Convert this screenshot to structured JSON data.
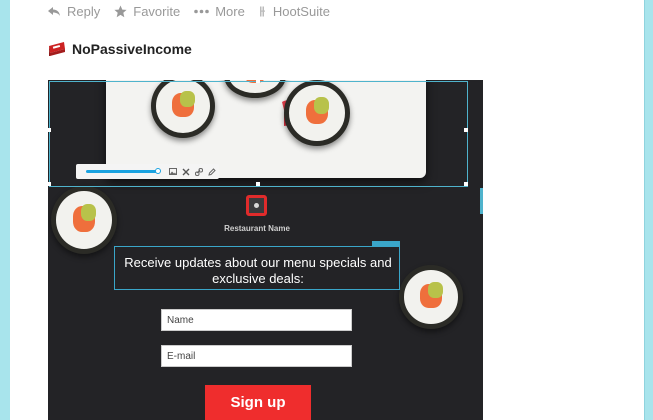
{
  "tweet_actions": [
    {
      "label": "Reply",
      "icon": "reply-icon"
    },
    {
      "label": "Favorite",
      "icon": "star-icon"
    },
    {
      "label": "More",
      "icon": "more-dots-icon"
    }
  ],
  "source": {
    "label": "HootSuite",
    "icon": "hootsuite-icon"
  },
  "author": {
    "name": "NoPassiveIncome",
    "avatar": "avatar-icon"
  },
  "media": {
    "restaurant_name": "Restaurant Name",
    "headline": "Receive updates about our menu specials and exclusive deals:",
    "name_placeholder": "Name",
    "email_placeholder": "E-mail",
    "signup_label": "Sign up",
    "zoom_level": 1.0,
    "colors": {
      "accent": "#ef2d2d",
      "selection": "#4fb3cc",
      "background": "#232326",
      "slider": "#1aa2e0",
      "frame": "#a8e4ec"
    }
  }
}
